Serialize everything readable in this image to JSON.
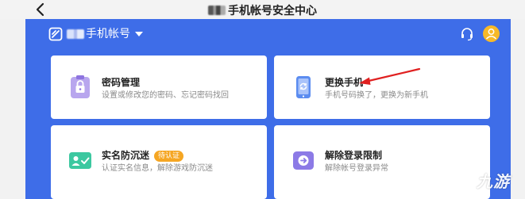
{
  "topbar": {
    "title_prefix_icon": "blurred-app-name",
    "title": "手机帐号安全中心",
    "back_icon": "chevron-left-icon"
  },
  "header": {
    "account_prefix_icon": "blurred-account-name",
    "account_label": "手机帐号",
    "logo_icon": "app-logo-icon",
    "dropdown_icon": "caret-down-icon",
    "support_icon": "headset-icon",
    "avatar_icon": "user-avatar-icon"
  },
  "colors": {
    "brand_blue": "#3e6de8",
    "card_bg": "#ffffff",
    "badge_orange": "#f5a623",
    "avatar_yellow": "#f7b928",
    "arrow_red": "#e02020"
  },
  "cards": [
    {
      "title": "密码管理",
      "description": "设置或修改您的密码、忘记密码找回",
      "icon": "lock-clipboard-icon"
    },
    {
      "title": "更换手机",
      "description": "手机号码换了，更换为新手机",
      "icon": "phone-refresh-icon"
    },
    {
      "title": "实名防沉迷",
      "badge": "待认证",
      "description": "认证实名信息，解除游戏防沉迷",
      "icon": "id-card-check-icon"
    },
    {
      "title": "解除登录限制",
      "description": "解除帐号登录异常",
      "icon": "unlock-arrow-icon"
    }
  ],
  "watermark": {
    "text": "九游",
    "icon": "jiuyou-logo-icon"
  }
}
